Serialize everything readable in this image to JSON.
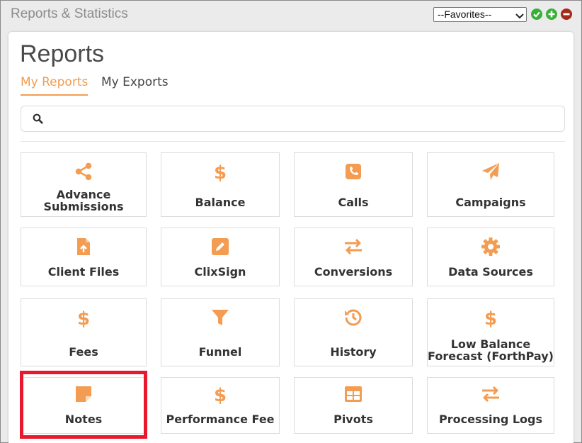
{
  "window": {
    "title": "Reports & Statistics"
  },
  "favorites": {
    "selected": "--Favorites--"
  },
  "page": {
    "title": "Reports"
  },
  "tabs": [
    {
      "label": "My Reports",
      "active": true
    },
    {
      "label": "My Exports",
      "active": false
    }
  ],
  "search": {
    "value": "",
    "placeholder": ""
  },
  "colors": {
    "accent": "#f39c52",
    "highlight": "#e8192c",
    "ok": "#38b038",
    "remove": "#a52a1a"
  },
  "reports": [
    {
      "label_line1": "Advance",
      "label_line2": "Submissions",
      "icon": "share-icon"
    },
    {
      "label_line1": "Balance",
      "label_line2": "",
      "icon": "dollar-icon"
    },
    {
      "label_line1": "Calls",
      "label_line2": "",
      "icon": "phone-icon"
    },
    {
      "label_line1": "Campaigns",
      "label_line2": "",
      "icon": "paper-plane-icon"
    },
    {
      "label_line1": "Client Files",
      "label_line2": "",
      "icon": "file-upload-icon"
    },
    {
      "label_line1": "ClixSign",
      "label_line2": "",
      "icon": "pen-square-icon"
    },
    {
      "label_line1": "Conversions",
      "label_line2": "",
      "icon": "exchange-icon"
    },
    {
      "label_line1": "Data Sources",
      "label_line2": "",
      "icon": "gear-icon"
    },
    {
      "label_line1": "Fees",
      "label_line2": "",
      "icon": "dollar-icon"
    },
    {
      "label_line1": "Funnel",
      "label_line2": "",
      "icon": "funnel-icon"
    },
    {
      "label_line1": "History",
      "label_line2": "",
      "icon": "history-icon"
    },
    {
      "label_line1": "Low Balance",
      "label_line2": "Forecast (ForthPay)",
      "icon": "dollar-icon"
    },
    {
      "label_line1": "Notes",
      "label_line2": "",
      "icon": "sticky-note-icon"
    },
    {
      "label_line1": "Performance Fee",
      "label_line2": "",
      "icon": "dollar-icon"
    },
    {
      "label_line1": "Pivots",
      "label_line2": "",
      "icon": "table-icon"
    },
    {
      "label_line1": "Processing Logs",
      "label_line2": "",
      "icon": "exchange-icon"
    }
  ]
}
